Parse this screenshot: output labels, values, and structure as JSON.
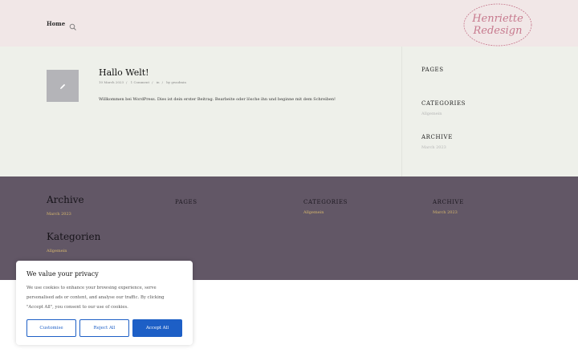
{
  "header": {
    "nav_home": "Home",
    "logo_line1": "Henriette",
    "logo_line2": "Redesign"
  },
  "post": {
    "title": "Hallo Welt!",
    "meta": [
      "10 March 2023",
      "1 Comment",
      "in",
      "by gwadmin"
    ],
    "excerpt": "Willkommen bei WordPress. Dies ist dein erster Beitrag. Bearbeite oder lösche ihn und beginne mit dem Schreiben!"
  },
  "sidebar": {
    "pages_heading": "PAGES",
    "categories_heading": "CATEGORIES",
    "categories_item": "Allgemein",
    "archive_heading": "ARCHIVE",
    "archive_item": "March 2023"
  },
  "footer": {
    "archive_title": "Archive",
    "archive_link": "March 2023",
    "kategorien_title": "Kategorien",
    "kategorien_link": "Allgemein",
    "pages_heading": "PAGES",
    "categories_heading": "CATEGORIES",
    "categories_link": "Allgemein",
    "archive_heading": "ARCHIVE",
    "archive_heading_link": "March 2023"
  },
  "cookie": {
    "title": "We value your privacy",
    "text": "We use cookies to enhance your browsing experience, serve personalised ads or content, and analyse our traffic. By clicking \"Accept All\", you consent to our use of cookies.",
    "customise": "Customise",
    "reject": "Reject All",
    "accept": "Accept All"
  },
  "colors": {
    "header_bg": "#f1e7e7",
    "main_bg": "#eef0ea",
    "footer_bg": "#625766",
    "footer_link": "#d9b96d",
    "accent_blue": "#1d5fc6",
    "logo_pink": "#c77a8e"
  },
  "icons": [
    "search-icon",
    "pencil-icon"
  ]
}
